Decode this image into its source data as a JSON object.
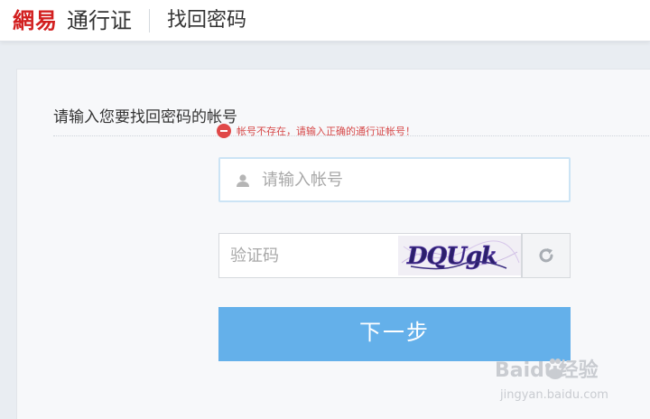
{
  "header": {
    "brand": "網易",
    "service": "通行证",
    "page_title": "找回密码"
  },
  "form": {
    "title": "请输入您要找回密码的帐号",
    "error_message": "帐号不存在，请输入正确的通行证帐号！",
    "account_placeholder": "请输入帐号",
    "account_value": "",
    "captcha_placeholder": "验证码",
    "captcha_value": "",
    "captcha_image_text": "DQUgk",
    "next_label": "下一步"
  },
  "watermark": {
    "logo": "Baidu经验",
    "url": "jingyan.baidu.com"
  },
  "colors": {
    "brand_red": "#d21f1f",
    "button_blue": "#64b0ea",
    "error_red": "#d64848"
  },
  "icons": [
    "user-icon",
    "error-icon",
    "refresh-icon",
    "paw-icon"
  ]
}
